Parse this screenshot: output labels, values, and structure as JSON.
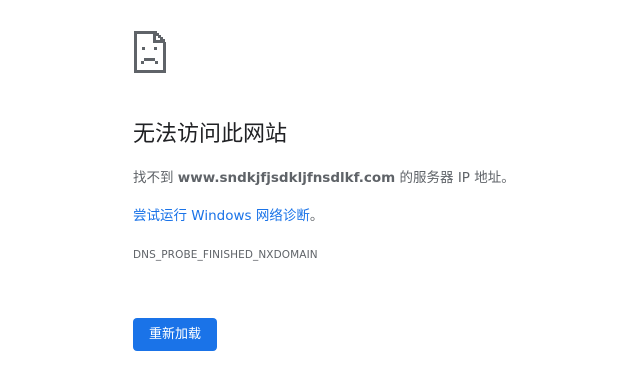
{
  "error": {
    "icon": "sad-page-icon",
    "title": "无法访问此网站",
    "message_prefix": "找不到 ",
    "domain": "www.sndkjfjsdkljfnsdlkf.com",
    "message_suffix": " 的服务器 IP 地址。",
    "suggestion_link": "尝试运行 Windows 网络诊断",
    "suggestion_punct": "。",
    "code": "DNS_PROBE_FINISHED_NXDOMAIN"
  },
  "actions": {
    "reload_label": "重新加载"
  },
  "colors": {
    "accent": "#1a73e8",
    "text_primary": "#202124",
    "text_secondary": "#5f6368",
    "background": "#ffffff"
  }
}
